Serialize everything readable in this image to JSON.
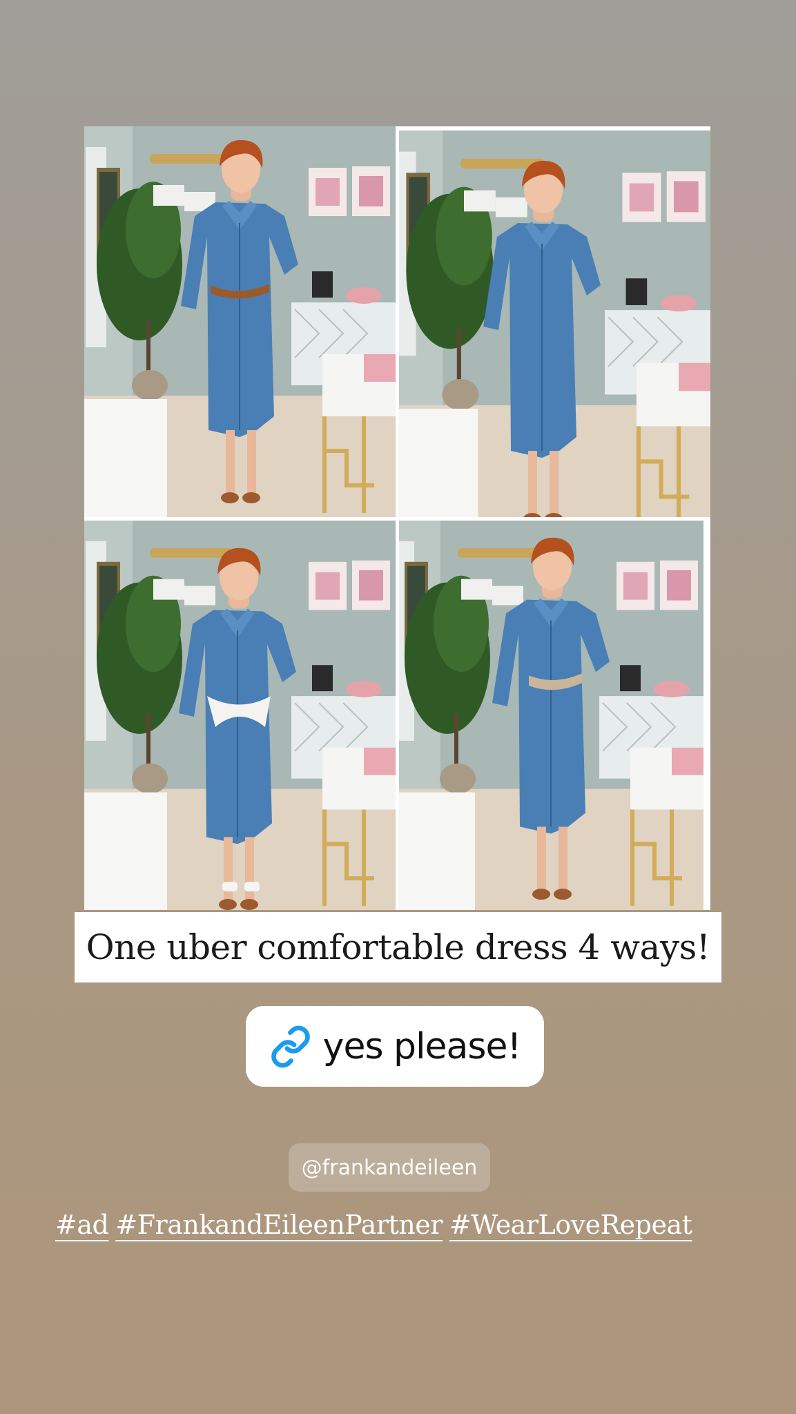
{
  "caption": "One uber comfortable dress 4 ways!",
  "link_sticker": {
    "icon": "link-icon",
    "label": "yes please!"
  },
  "mention": "@frankandeileen",
  "hashtags": [
    "#ad",
    "#FrankandEileenPartner",
    "#WearLoveRepeat"
  ],
  "colors": {
    "link_accent": "#1d9bf0",
    "denim": "#4a7fb5",
    "wall": "#aab8b5"
  }
}
